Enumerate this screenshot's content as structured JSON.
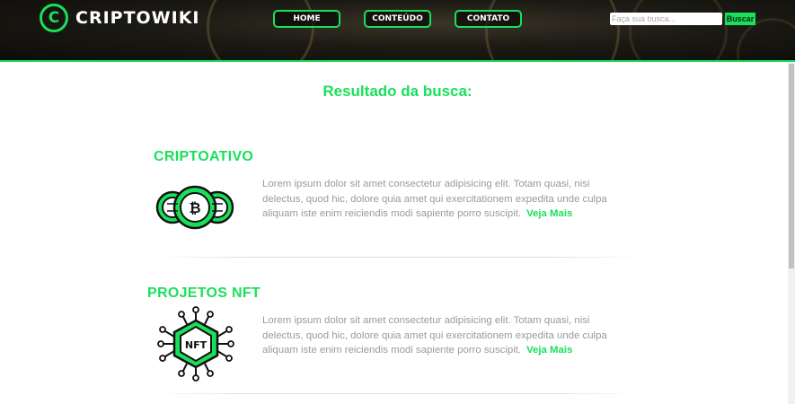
{
  "header": {
    "brand": "CRIPTOWIKI",
    "logo_letter": "C",
    "nav": [
      {
        "label": "HOME"
      },
      {
        "label": "CONTEÚDO"
      },
      {
        "label": "CONTATO"
      }
    ],
    "search": {
      "placeholder": "Faça sua busca...",
      "button_label": "Buscar"
    }
  },
  "main": {
    "title": "Resultado da busca:",
    "results": [
      {
        "title": "CRIPTOATIVO",
        "text": "Lorem ipsum dolor sit amet consectetur adipisicing elit. Totam quasi, nisi delectus, quod hic, dolore quia amet qui exercitationem expedita unde culpa aliquam iste enim reiciendis modi sapiente porro suscipit.",
        "link": "Veja Mais",
        "icon": "crypto-coins-icon"
      },
      {
        "title": "PROJETOS NFT",
        "text": "Lorem ipsum dolor sit amet consectetur adipisicing elit. Totam quasi, nisi delectus, quod hic, dolore quia amet qui exercitationem expedita unde culpa aliquam iste enim reiciendis modi sapiente porro suscipit.",
        "link": "Veja Mais",
        "icon": "nft-chip-icon",
        "icon_label": "NFT"
      }
    ]
  },
  "colors": {
    "accent": "#19e05a",
    "text_muted": "#9a9a9a",
    "header_bg": "#1c1a14"
  }
}
